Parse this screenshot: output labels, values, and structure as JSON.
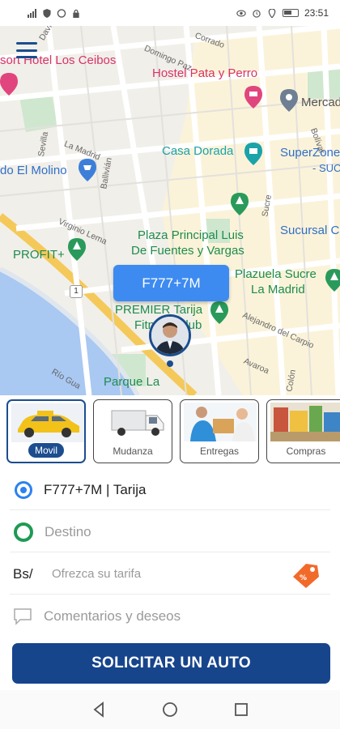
{
  "status_bar": {
    "time": "23:51"
  },
  "map": {
    "plus_code_bubble": "F777+7M",
    "labels": {
      "hotel_ceibos": "sort Hotel Los Ceibos",
      "hostel": "Hostel Pata y Perro",
      "mercado": "Mercad",
      "casa_dorada": "Casa Dorada",
      "superzone": "SuperZone",
      "suc": "- SUC",
      "el_molino": "do El Molino",
      "plaza_principal_1": "Plaza Principal Luis",
      "plaza_principal_2": "De Fuentes y Vargas",
      "sucursal": "Sucursal C",
      "profit": "PROFIT+",
      "plazuela_1": "Plazuela Sucre",
      "plazuela_2": "La Madrid",
      "premier_1": "PREMIER Tarija",
      "premier_2": "Fitness Club",
      "parque": "Parque La",
      "street_corrado": "Corrado",
      "street_domingo": "Domingo Paz",
      "street_lamadrid": "La Madrid",
      "street_sevilla": "Sevilla",
      "street_ballivian": "Ballivián",
      "street_virginio": "Virginio Lema",
      "street_sucre": "Sucre",
      "street_bolivar": "Bolívar",
      "street_alejandro": "Alejandro del Carpio",
      "street_avaroa": "Avaroa",
      "street_colon": "Colón",
      "street_route": "1",
      "street_davi": "Davi",
      "street_rio": "Río Gua"
    }
  },
  "services": [
    {
      "label": "Movil",
      "active": true
    },
    {
      "label": "Mudanza",
      "active": false
    },
    {
      "label": "Entregas",
      "active": false
    },
    {
      "label": "Compras",
      "active": false
    }
  ],
  "form": {
    "origin_value": "F777+7M | Tarija",
    "destination_placeholder": "Destino",
    "currency_label": "Bs/",
    "fare_placeholder": "Ofrezca su tarifa",
    "comments_placeholder": "Comentarios y deseos"
  },
  "cta": {
    "label": "SOLICITAR UN AUTO"
  },
  "colors": {
    "primary": "#17458c",
    "origin_dot": "#2b82f0",
    "destination_dot": "#1f9a54",
    "plus_code_bubble": "#3d8bf0"
  }
}
